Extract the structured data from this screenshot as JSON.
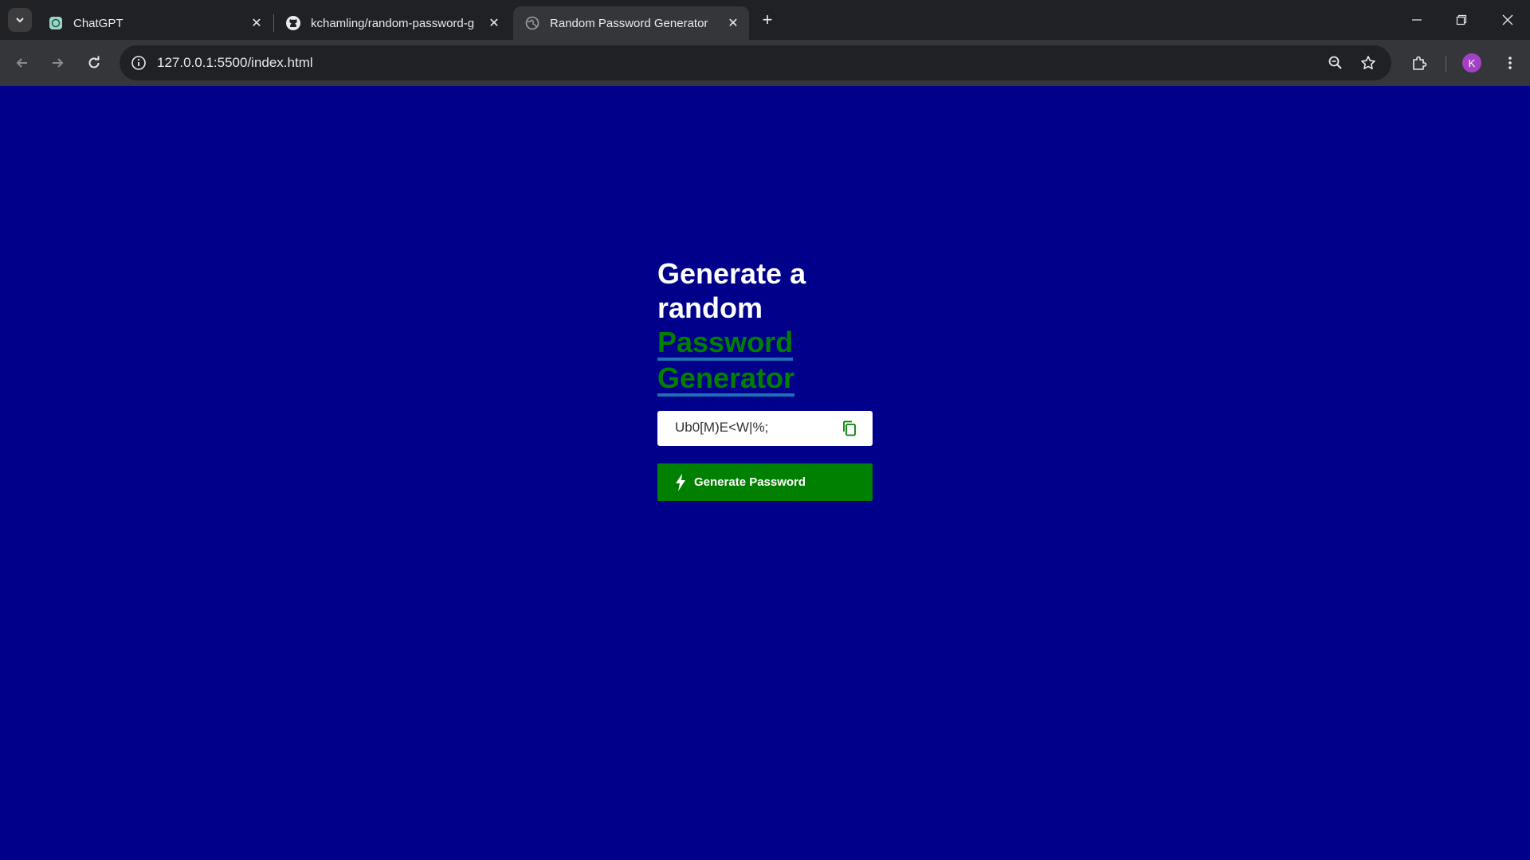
{
  "browser": {
    "tabs": [
      {
        "title": "ChatGPT",
        "favicon": "chatgpt-icon",
        "active": false
      },
      {
        "title": "kchamling/random-password-g",
        "favicon": "github-icon",
        "active": false
      },
      {
        "title": "Random Password Generator",
        "favicon": "globe-icon",
        "active": true
      }
    ],
    "new_tab_label": "+",
    "url": "127.0.0.1:5500/index.html",
    "profile_initial": "K",
    "colors": {
      "tabbar": "#202124",
      "toolbar": "#35363a",
      "avatar": "#a142c4"
    }
  },
  "page": {
    "heading_line1": "Generate a",
    "heading_line2": "random",
    "heading_highlight1": "Password",
    "heading_highlight2": "Generator",
    "password_value": "Ub0[M)E<W|%;",
    "generate_button_label": "Generate Password",
    "colors": {
      "background": "#00008b",
      "accent": "#008000",
      "underline": "#1e6fb8"
    }
  }
}
